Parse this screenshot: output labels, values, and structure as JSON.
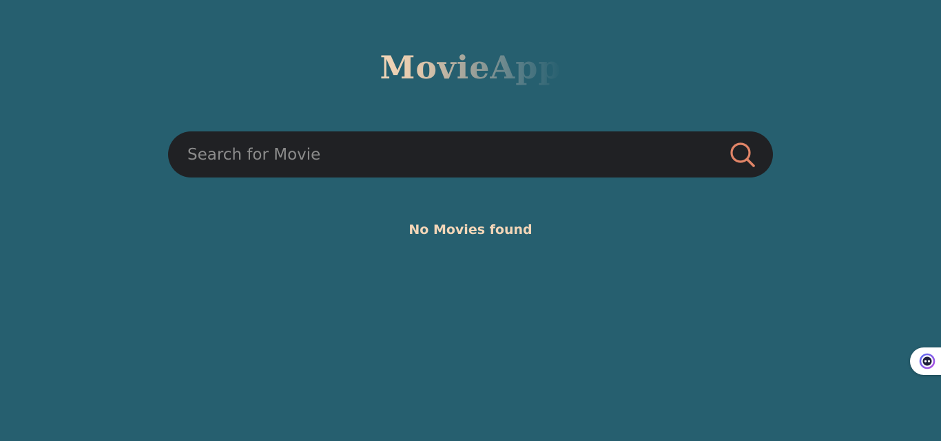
{
  "app": {
    "title": "MovieApp"
  },
  "search": {
    "placeholder": "Search for Movie",
    "value": "",
    "icon": "search-icon"
  },
  "results": {
    "empty_message": "No Movies found"
  },
  "assistant_widget": {
    "icon": "assistant-face-icon"
  },
  "colors": {
    "background": "#265f6f",
    "search_bar": "#202124",
    "accent": "#e08467",
    "title_light": "#f3d6b8",
    "message": "#f3d6b8"
  }
}
